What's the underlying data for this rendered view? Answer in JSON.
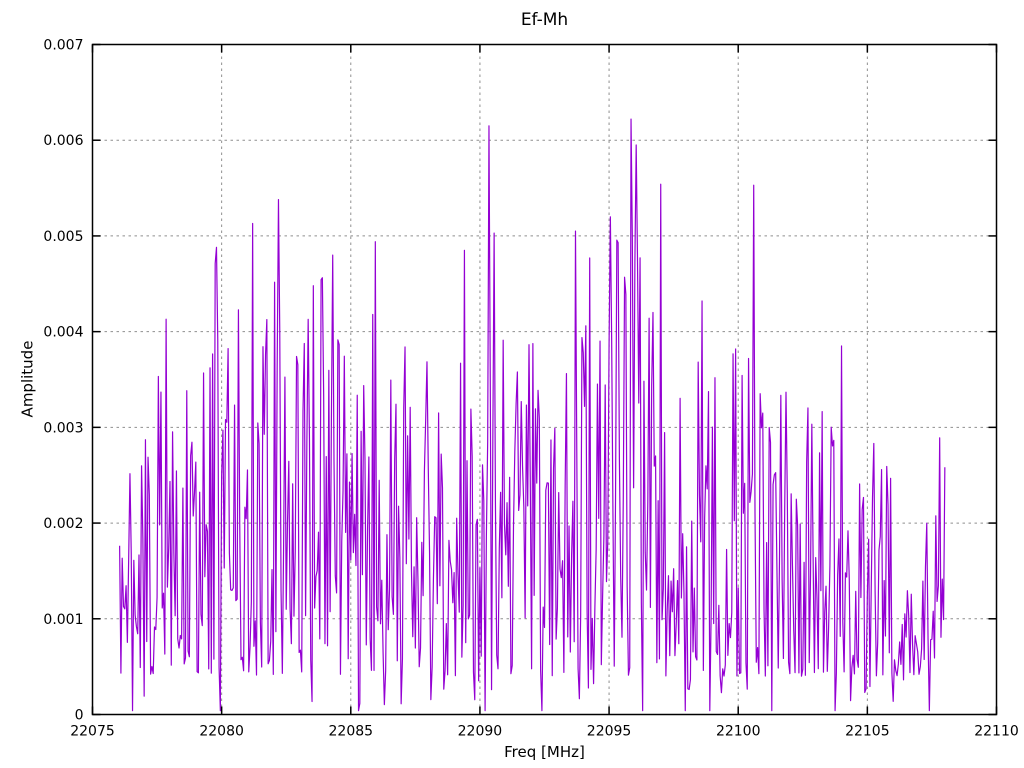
{
  "page": {
    "background": "#ffffff"
  },
  "chart_data": {
    "type": "line",
    "render_style": "dense-noise-spectrum (gnuplot lines)",
    "title": "Ef-Mh",
    "xlabel": "Freq [MHz]",
    "ylabel": "Amplitude",
    "xlim": [
      22075,
      22110
    ],
    "ylim": [
      0,
      0.007
    ],
    "xticks": [
      22075,
      22080,
      22085,
      22090,
      22095,
      22100,
      22105,
      22110
    ],
    "xtick_labels": [
      "22075",
      "22080",
      "22085",
      "22090",
      "22095",
      "22100",
      "22105",
      "22110"
    ],
    "yticks": [
      0,
      0.001,
      0.002,
      0.003,
      0.004,
      0.005,
      0.006,
      0.007
    ],
    "ytick_labels": [
      "0",
      "0.001",
      "0.002",
      "0.003",
      "0.004",
      "0.005",
      "0.006",
      "0.007"
    ],
    "grid": {
      "visible": true,
      "color": "#8f8f8f",
      "dash": [
        2.5,
        3.5
      ]
    },
    "border_color": "#000000",
    "text_color": "#000000",
    "legend": "none",
    "series": [
      {
        "name": "Ef-Mh",
        "color": "#9400d3",
        "line_width": 1.2,
        "freq_start": 22076.05,
        "freq_end": 22108.0,
        "freq_step": 0.05,
        "amp_floor": 0.0004,
        "noise_seed": 1234567,
        "noise_exponent": 1.5,
        "dip_probability": 0.05,
        "envelope": [
          [
            22075.9,
            0.0026
          ],
          [
            22076.3,
            0.003
          ],
          [
            22077.0,
            0.0036
          ],
          [
            22077.9,
            0.0041
          ],
          [
            22078.4,
            0.004
          ],
          [
            22079.0,
            0.0031
          ],
          [
            22079.8,
            0.0049
          ],
          [
            22080.3,
            0.0038
          ],
          [
            22081.2,
            0.0051
          ],
          [
            22081.7,
            0.004
          ],
          [
            22082.2,
            0.0054
          ],
          [
            22082.8,
            0.0044
          ],
          [
            22083.4,
            0.0044
          ],
          [
            22084.3,
            0.0048
          ],
          [
            22085.0,
            0.004
          ],
          [
            22085.9,
            0.0049
          ],
          [
            22086.6,
            0.0036
          ],
          [
            22087.3,
            0.0041
          ],
          [
            22088.0,
            0.004
          ],
          [
            22088.7,
            0.0038
          ],
          [
            22089.3,
            0.0048
          ],
          [
            22090.0,
            0.0044
          ],
          [
            22090.4,
            0.005
          ],
          [
            22091.0,
            0.0043
          ],
          [
            22091.8,
            0.004
          ],
          [
            22092.5,
            0.0037
          ],
          [
            22093.2,
            0.0043
          ],
          [
            22093.8,
            0.0046
          ],
          [
            22094.5,
            0.0046
          ],
          [
            22095.1,
            0.0049
          ],
          [
            22095.9,
            0.0052
          ],
          [
            22096.6,
            0.0044
          ],
          [
            22097.1,
            0.0048
          ],
          [
            22097.8,
            0.0038
          ],
          [
            22098.4,
            0.004
          ],
          [
            22099.0,
            0.0035
          ],
          [
            22099.7,
            0.0039
          ],
          [
            22100.4,
            0.004
          ],
          [
            22101.0,
            0.0037
          ],
          [
            22101.8,
            0.0034
          ],
          [
            22102.5,
            0.0036
          ],
          [
            22103.2,
            0.0033
          ],
          [
            22104.0,
            0.0035
          ],
          [
            22104.8,
            0.003
          ],
          [
            22105.4,
            0.0029
          ],
          [
            22106.0,
            0.0025
          ],
          [
            22106.7,
            0.0022
          ],
          [
            22107.3,
            0.0021
          ],
          [
            22108.0,
            0.0029
          ]
        ],
        "peaks": [
          [
            22077.85,
            0.00413
          ],
          [
            22079.8,
            0.00488
          ],
          [
            22081.2,
            0.00513
          ],
          [
            22082.2,
            0.00538
          ],
          [
            22083.55,
            0.00448
          ],
          [
            22084.3,
            0.0048
          ],
          [
            22085.95,
            0.00494
          ],
          [
            22089.4,
            0.00485
          ],
          [
            22090.35,
            0.00615
          ],
          [
            22090.55,
            0.00503
          ],
          [
            22093.7,
            0.00505
          ],
          [
            22094.25,
            0.00477
          ],
          [
            22095.05,
            0.0052
          ],
          [
            22095.85,
            0.00622
          ],
          [
            22096.05,
            0.00595
          ],
          [
            22097.0,
            0.00554
          ],
          [
            22098.6,
            0.00432
          ],
          [
            22100.6,
            0.00553
          ],
          [
            22104.0,
            0.00385
          ],
          [
            22107.8,
            0.00289
          ]
        ],
        "dropouts": [
          22076.55,
          22079.95,
          22085.3,
          22090.2,
          22092.4,
          22096.3,
          22097.95,
          22098.9,
          22101.3,
          22103.75,
          22107.4
        ]
      }
    ]
  }
}
